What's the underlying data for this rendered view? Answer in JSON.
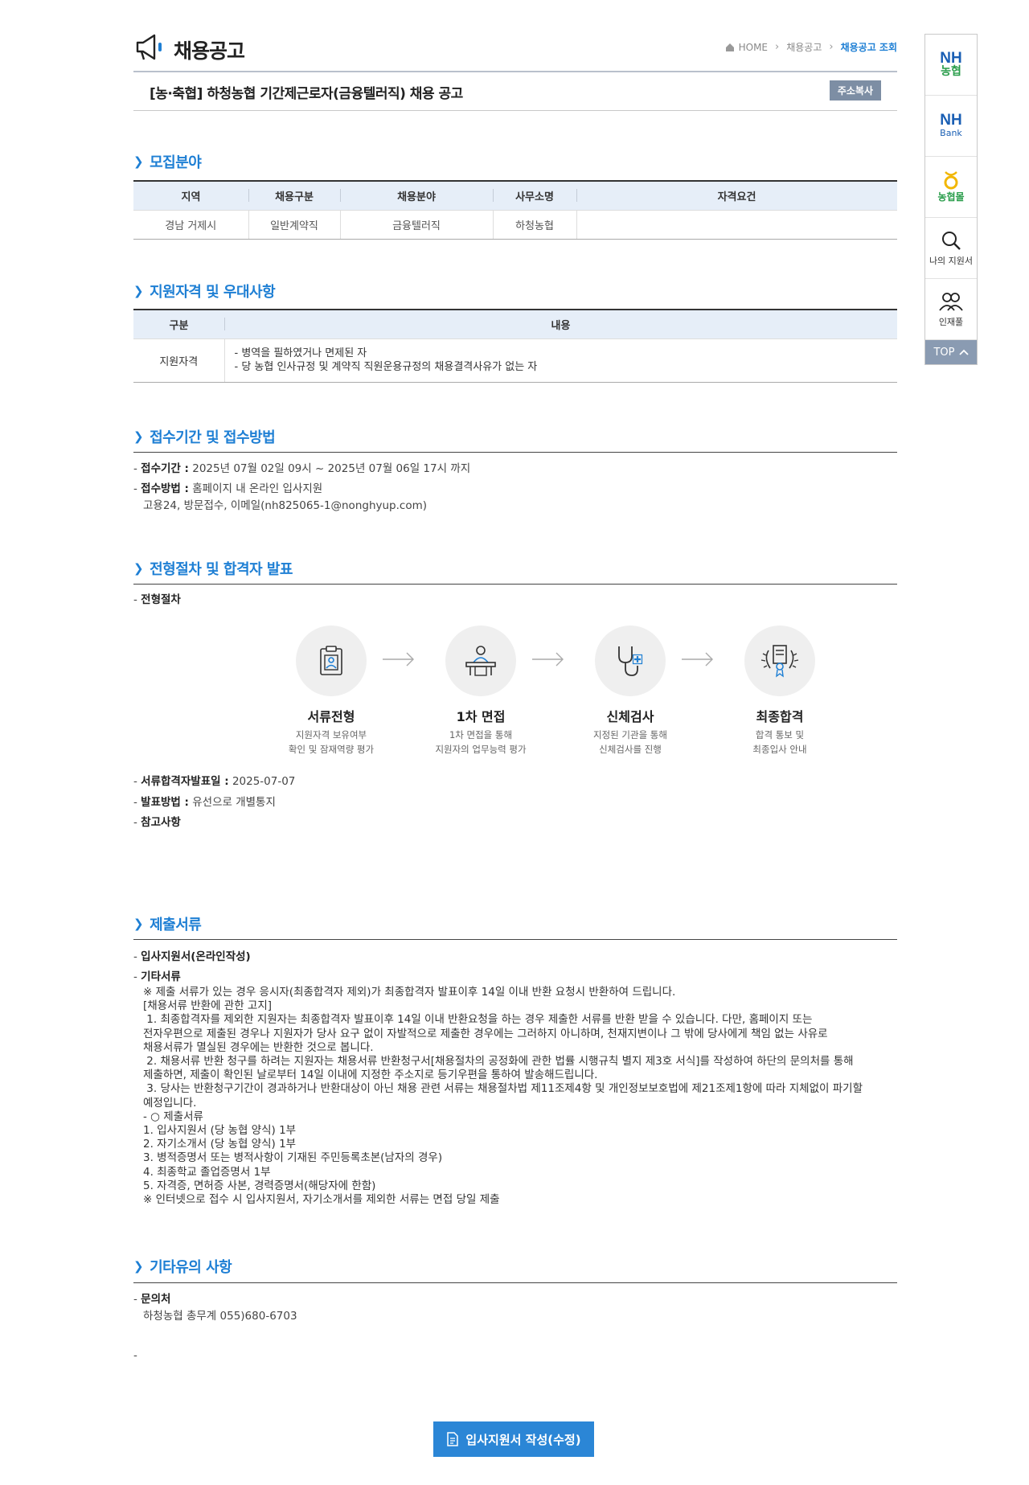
{
  "header": {
    "title": "채용공고",
    "breadcrumb": [
      "HOME",
      "채용공고",
      "채용공고 조회"
    ]
  },
  "job": {
    "title": "[농·축협] 하청농협 기간제근로자(금융텔러직) 채용 공고",
    "copy_button": "주소복사"
  },
  "recruit": {
    "title": "모집분야",
    "columns": [
      "지역",
      "채용구분",
      "채용분야",
      "사무소명",
      "자격요건"
    ],
    "row": [
      "경남 거제시",
      "일반계약직",
      "금융텔러직",
      "하청농협",
      ""
    ]
  },
  "qualification": {
    "title": "지원자격 및 우대사항",
    "columns": [
      "구분",
      "내용"
    ],
    "row_label": "지원자격",
    "lines": [
      "- 병역을 필하였거나 면제된 자",
      "- 당 농협 인사규정 및 계약직 직원운용규정의 채용결격사유가 없는 자"
    ]
  },
  "reception": {
    "title": "접수기간 및 접수방법",
    "period_label": "접수기간 :",
    "period_value": "2025년 07월 02일 09시 ~ 2025년 07월 06일 17시 까지",
    "method_label": "접수방법 :",
    "method_value": "홈페이지 내 온라인 입사지원",
    "method_extra": "고용24, 방문접수, 이메일(nh825065-1@nonghyup.com)"
  },
  "process": {
    "title": "전형절차 및 합격자 발표",
    "sub_label": "전형절차",
    "steps": [
      {
        "name": "서류전형",
        "desc1": "지원자격 보유여부",
        "desc2": "확인 및 잠재역량 평가"
      },
      {
        "name": "1차 면접",
        "desc1": "1차 면접을 통해",
        "desc2": "지원자의 업무능력 평가"
      },
      {
        "name": "신체검사",
        "desc1": "지정된 기관을 통해",
        "desc2": "신체검사를 진행"
      },
      {
        "name": "최종합격",
        "desc1": "합격 통보 및",
        "desc2": "최종입사 안내"
      }
    ],
    "announce_label": "서류합격자발표일 :",
    "announce_value": "2025-07-07",
    "notice_label": "발표방법 :",
    "notice_value": "유선으로 개별통지",
    "ref_label": "참고사항"
  },
  "documents": {
    "title": "제출서류",
    "item1": "입사지원서(온라인작성)",
    "item2": "기타서류",
    "body": "※ 제출 서류가 있는 경우 응시자(최종합격자 제외)가 최종합격자 발표이후 14일 이내 반환 요청시 반환하여 드립니다.\n[채용서류 반환에 관한 고지]\n 1. 최종합격자를 제외한 지원자는 최종합격자 발표이후 14일 이내 반환요청을 하는 경우 제출한 서류를 반환 받을 수 있습니다. 다만, 홈페이지 또는\n전자우편으로 제출된 경우나 지원자가 당사 요구 없이 자발적으로 제출한 경우에는 그러하지 아니하며, 천재지변이나 그 밖에 당사에게 책임 없는 사유로\n채용서류가 멸실된 경우에는 반환한 것으로 봅니다.\n 2. 채용서류 반환 청구를 하려는 지원자는 채용서류 반환청구서[채용절차의 공정화에 관한 법률 시행규칙 별지 제3호 서식]를 작성하여 하단의 문의처를 통해\n제출하면, 제출이 확인된 날로부터 14일 이내에 지정한 주소지로 등기우편을 통하여 발송해드립니다.\n 3. 당사는 반환청구기간이 경과하거나 반환대상이 아닌 채용 관련 서류는 채용절차법 제11조제4항 및 개인정보보호법에 제21조제1항에 따라 지체없이 파기할\n예정입니다.\n- ○ 제출서류\n1. 입사지원서 (당 농협 양식) 1부\n2. 자기소개서 (당 농협 양식) 1부\n3. 병적증명서 또는 병적사항이 기재된 주민등록초본(남자의 경우)\n4. 최종학교 졸업증명서 1부\n5. 자격증, 면허증 사본, 경력증명서(해당자에 한함)\n※ 인터넷으로 접수 시 입사지원서, 자기소개서를 제외한 서류는 면접 당일 제출"
  },
  "etc": {
    "title": "기타유의 사항",
    "contact_label": "문의처",
    "contact_value": "하청농협 총무계 055)680-6703"
  },
  "apply_button": "입사지원서 작성(수정)",
  "sidebar": {
    "nh_nonghyup": [
      "NH",
      "농협"
    ],
    "nh_bank": [
      "NH",
      "Bank"
    ],
    "nonghyupmall": "농협몰",
    "my_application": "나의 지원서",
    "talent_pool": "인재풀",
    "top": "TOP"
  },
  "colors": {
    "accent": "#1e7fd4",
    "nh_blue": "#1a5fb4",
    "nh_green": "#2a9d4b",
    "button_gray": "#7d8ea4"
  }
}
